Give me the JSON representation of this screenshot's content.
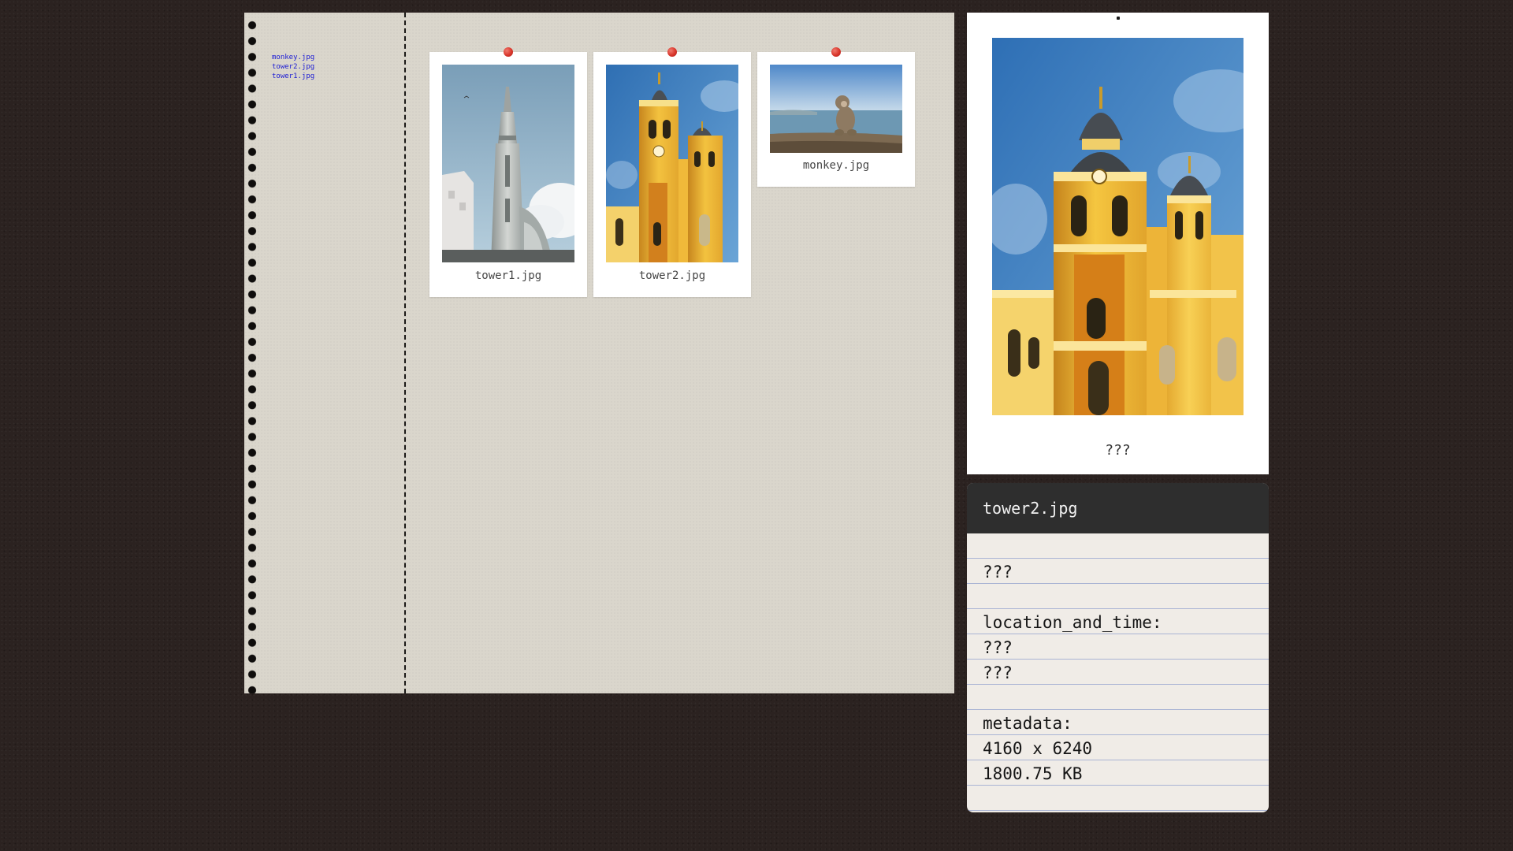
{
  "sidebar": {
    "files": [
      {
        "label": "monkey.jpg"
      },
      {
        "label": "tower2.jpg"
      },
      {
        "label": "tower1.jpg"
      }
    ]
  },
  "cards": [
    {
      "caption": "tower1.jpg",
      "subject": "white-tower-photo"
    },
    {
      "caption": "tower2.jpg",
      "subject": "yellow-church-photo"
    },
    {
      "caption": "monkey.jpg",
      "subject": "monkey-photo"
    }
  ],
  "preview": {
    "caption": "???"
  },
  "details": {
    "title": "tower2.jpg",
    "lines": [
      "",
      "???",
      "",
      "location_and_time:",
      "???",
      "???",
      "",
      "metadata:",
      "4160 x 6240",
      "1800.75 KB",
      ""
    ]
  },
  "colors": {
    "background": "#2b2220",
    "paper": "#dad6cc",
    "link": "#1a1ad4",
    "pin": "#d9362b",
    "details_header": "#2e2e2e",
    "details_body": "#f0ece7",
    "rule_line": "#aab4d4"
  }
}
